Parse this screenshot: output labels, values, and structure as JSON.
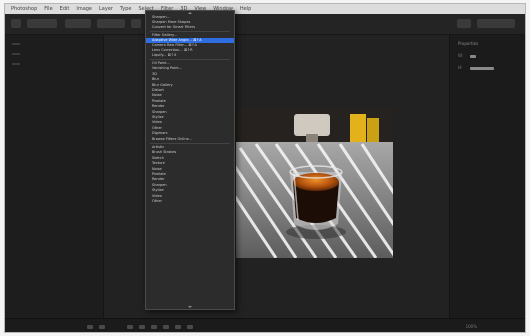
{
  "menubar": {
    "items": [
      "Photoshop",
      "File",
      "Edit",
      "Image",
      "Layer",
      "Type",
      "Select",
      "Filter",
      "3D",
      "View",
      "Window",
      "Help"
    ]
  },
  "menu": {
    "header_items": [
      {
        "label": "Sharpen...",
        "selected": false
      },
      {
        "label": "Sharpen More Shapes",
        "selected": false
      },
      {
        "label": "Convert for Smart Filters",
        "selected": false
      },
      {
        "label": "Filter Gallery...",
        "selected": false
      },
      {
        "label": "Adaptive Wide Angle...   ⌘↑A",
        "selected": true
      },
      {
        "label": "Camera Raw Filter...   ⌘↑A",
        "selected": false
      },
      {
        "label": "Lens Correction...   ⌘↑R",
        "selected": false
      },
      {
        "label": "Liquify...   ⌘↑X",
        "selected": false
      }
    ],
    "items": [
      "Oil Paint...",
      "Vanishing Point...",
      "3D",
      "Blur",
      "Blur Gallery",
      "Distort",
      "Noise",
      "Pixelate",
      "Render",
      "Sharpen",
      "Stylize",
      "Video",
      "Other",
      "Digimarc",
      "Browse Filters Online...",
      "Artistic",
      "Brush Strokes",
      "Sketch",
      "Texture",
      "Noise",
      "Pixelate",
      "Render",
      "Sharpen",
      "Stylize",
      "Video",
      "Other"
    ]
  },
  "right_panel": {
    "title": "Properties",
    "rows": [
      "W:",
      "H:",
      "X:",
      "Y:"
    ]
  },
  "status": {
    "zoom": "100%"
  },
  "colors": {
    "accent": "#2e6ee0",
    "background": "#202020",
    "panel": "#1b1b1b"
  },
  "photo": {
    "subject": "espresso-shot-glass"
  }
}
